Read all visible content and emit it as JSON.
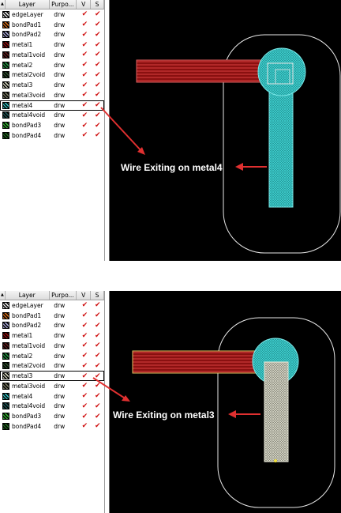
{
  "header": {
    "sort": "▲",
    "layer": "Layer",
    "purpose": "Purpo...",
    "v": "V",
    "s": "S"
  },
  "panels": [
    {
      "layers": [
        {
          "name": "edgeLayer",
          "purpose": "drw",
          "v": "✔",
          "s": "✔",
          "color": "#dcdcdc"
        },
        {
          "name": "bondPad1",
          "purpose": "drw",
          "v": "✔",
          "s": "✔",
          "color": "#c86414"
        },
        {
          "name": "bondPad2",
          "purpose": "drw",
          "v": "✔",
          "s": "✔",
          "color": "#9c9cc8"
        },
        {
          "name": "metal1",
          "purpose": "drw",
          "v": "✔",
          "s": "✔",
          "color": "#8a0a0a"
        },
        {
          "name": "metal1void",
          "purpose": "drw",
          "v": "✔",
          "s": "✔",
          "color": "#5a1a1a"
        },
        {
          "name": "metal2",
          "purpose": "drw",
          "v": "✔",
          "s": "✔",
          "color": "#1e8c3c"
        },
        {
          "name": "metal2void",
          "purpose": "drw",
          "v": "✔",
          "s": "✔",
          "color": "#2a4a2a"
        },
        {
          "name": "metal3",
          "purpose": "drw",
          "v": "✔",
          "s": "✔",
          "color": "#c8c8b4"
        },
        {
          "name": "metal3void",
          "purpose": "drw",
          "v": "✔",
          "s": "✔",
          "color": "#6e6e5a"
        },
        {
          "name": "metal4",
          "purpose": "drw",
          "v": "✔",
          "s": "✔",
          "color": "#2cb4b4"
        },
        {
          "name": "metal4void",
          "purpose": "drw",
          "v": "✔",
          "s": "✔",
          "color": "#1c5050"
        },
        {
          "name": "bondPad3",
          "purpose": "drw",
          "v": "✔",
          "s": "✔",
          "color": "#2caa2c"
        },
        {
          "name": "bondPad4",
          "purpose": "drw",
          "v": "✔",
          "s": "✔",
          "color": "#1e641e"
        }
      ],
      "selected_index": 9,
      "annotation": "Wire Exiting on metal4"
    },
    {
      "layers": [
        {
          "name": "edgeLayer",
          "purpose": "drw",
          "v": "✔",
          "s": "✔",
          "color": "#dcdcdc"
        },
        {
          "name": "bondPad1",
          "purpose": "drw",
          "v": "✔",
          "s": "✔",
          "color": "#c86414"
        },
        {
          "name": "bondPad2",
          "purpose": "drw",
          "v": "✔",
          "s": "✔",
          "color": "#9c9cc8"
        },
        {
          "name": "metal1",
          "purpose": "drw",
          "v": "✔",
          "s": "✔",
          "color": "#8a0a0a"
        },
        {
          "name": "metal1void",
          "purpose": "drw",
          "v": "✔",
          "s": "✔",
          "color": "#5a1a1a"
        },
        {
          "name": "metal2",
          "purpose": "drw",
          "v": "✔",
          "s": "✔",
          "color": "#1e8c3c"
        },
        {
          "name": "metal2void",
          "purpose": "drw",
          "v": "✔",
          "s": "✔",
          "color": "#2a4a2a"
        },
        {
          "name": "metal3",
          "purpose": "drw",
          "v": "✔",
          "s": "✔",
          "color": "#c8c8b4"
        },
        {
          "name": "metal3void",
          "purpose": "drw",
          "v": "✔",
          "s": "✔",
          "color": "#6e6e5a"
        },
        {
          "name": "metal4",
          "purpose": "drw",
          "v": "✔",
          "s": "✔",
          "color": "#2cb4b4"
        },
        {
          "name": "metal4void",
          "purpose": "drw",
          "v": "✔",
          "s": "✔",
          "color": "#1c5050"
        },
        {
          "name": "bondPad3",
          "purpose": "drw",
          "v": "✔",
          "s": "✔",
          "color": "#2caa2c"
        },
        {
          "name": "bondPad4",
          "purpose": "drw",
          "v": "✔",
          "s": "✔",
          "color": "#1e641e"
        }
      ],
      "selected_index": 7,
      "annotation": "Wire Exiting on metal3"
    }
  ],
  "colors": {
    "arrow": "#e03030",
    "metal1_wire": "#b41e1e",
    "metal4": "#2cb4b4",
    "metal3": "#d4d4c0",
    "outline": "#e8e8e8"
  }
}
